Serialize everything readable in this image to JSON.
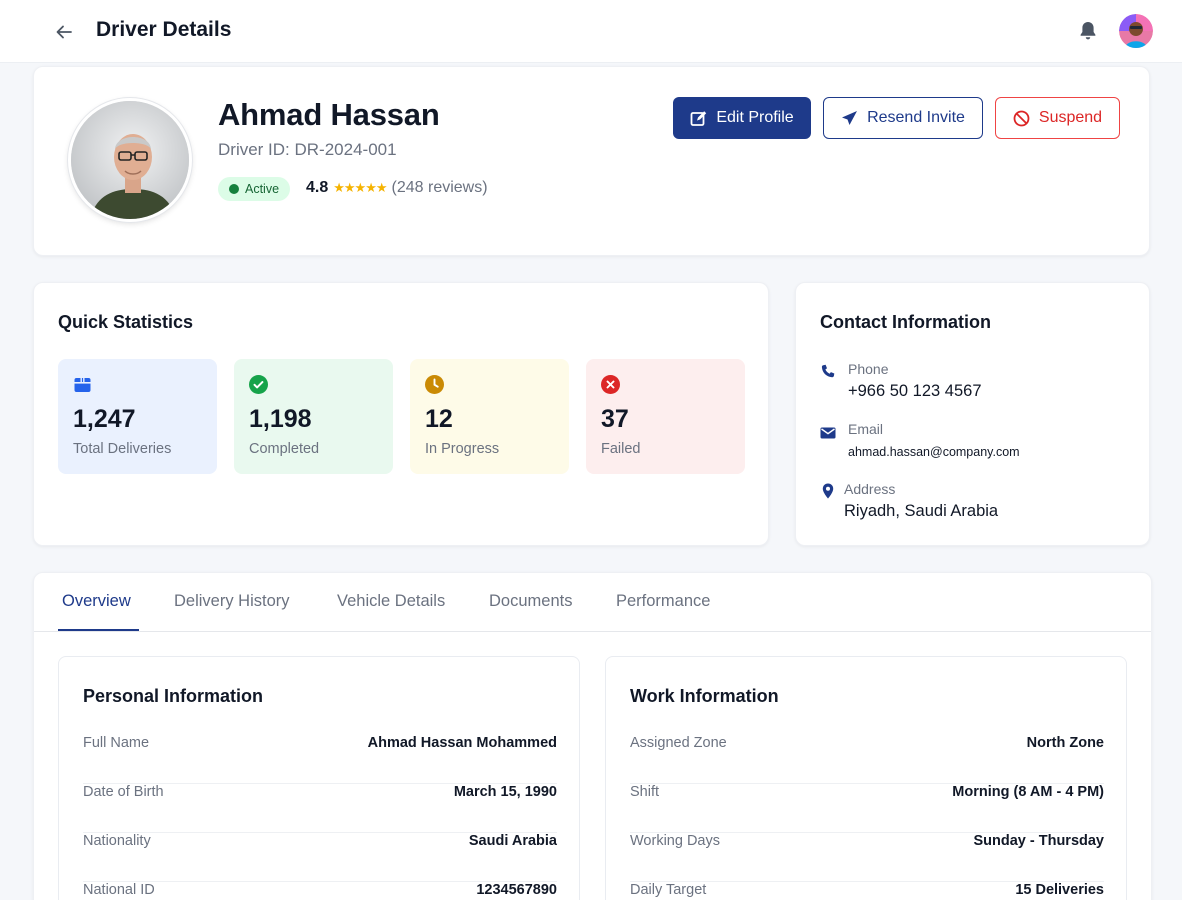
{
  "header": {
    "title": "Driver Details",
    "back_icon": "arrow-left-icon",
    "notification_icon": "bell-icon"
  },
  "profile": {
    "name": "Ahmad Hassan",
    "driver_id": "Driver ID: DR-2024-001",
    "status": "Active",
    "rating": "4.8",
    "stars": "★★★★★",
    "reviews": "(248 reviews)",
    "buttons": {
      "edit": "Edit Profile",
      "resend": "Resend Invite",
      "suspend": "Suspend"
    }
  },
  "stats": {
    "title": "Quick Statistics",
    "items": [
      {
        "value": "1,247",
        "label": "Total Deliveries",
        "icon": "box-icon",
        "color": "#2563eb"
      },
      {
        "value": "1,198",
        "label": "Completed",
        "icon": "check-circle-icon",
        "color": "#16a34a"
      },
      {
        "value": "12",
        "label": "In Progress",
        "icon": "clock-icon",
        "color": "#ca8a04"
      },
      {
        "value": "37",
        "label": "Failed",
        "icon": "x-circle-icon",
        "color": "#dc2626"
      }
    ]
  },
  "contact": {
    "title": "Contact Information",
    "phone_label": "Phone",
    "phone": "+966 50 123 4567",
    "email_label": "Email",
    "email": "ahmad.hassan@company.com",
    "address_label": "Address",
    "address": "Riyadh, Saudi Arabia"
  },
  "tabs": [
    "Overview",
    "Delivery History",
    "Vehicle Details",
    "Documents",
    "Performance"
  ],
  "personal": {
    "title": "Personal Information",
    "rows": [
      {
        "k": "Full Name",
        "v": "Ahmad Hassan Mohammed"
      },
      {
        "k": "Date of Birth",
        "v": "March 15, 1990"
      },
      {
        "k": "Nationality",
        "v": "Saudi Arabia"
      },
      {
        "k": "National ID",
        "v": "1234567890"
      }
    ]
  },
  "work": {
    "title": "Work Information",
    "rows": [
      {
        "k": "Assigned Zone",
        "v": "North Zone"
      },
      {
        "k": "Shift",
        "v": "Morning (8 AM - 4 PM)"
      },
      {
        "k": "Working Days",
        "v": "Sunday - Thursday"
      },
      {
        "k": "Daily Target",
        "v": "15 Deliveries"
      }
    ]
  },
  "colors": {
    "primary": "#1e3a8a",
    "danger": "#dc2626",
    "success_bg": "#dcfce7"
  }
}
